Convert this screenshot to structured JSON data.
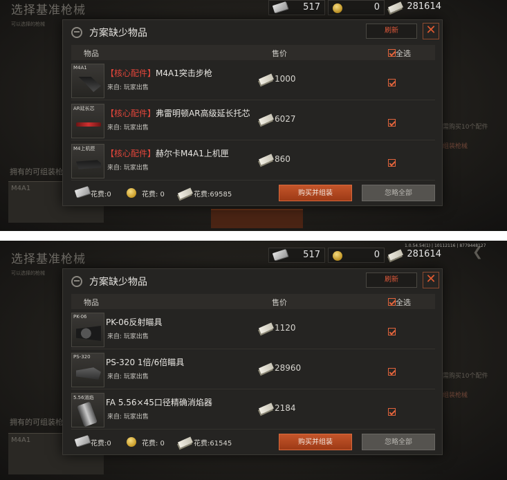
{
  "screens": [
    {
      "bg": {
        "title": "选择基准枪械",
        "subtitle": "可以选择的枪械",
        "owned_label": "拥有的可组装枪",
        "owned_weapon": "M4A1",
        "right_text_1": "需购买10个配件",
        "right_text_2": "组装枪械"
      },
      "version": "",
      "currency": {
        "cash": "517",
        "coin": "0",
        "money": "281614"
      },
      "dialog": {
        "title": "方案缺少物品",
        "refresh": "刷新",
        "close": "✕",
        "col_item": "物品",
        "col_price": "售价",
        "col_all": "全选",
        "rows": [
          {
            "tag": "M4A1",
            "core": "【核心配件】",
            "name": "M4A1突击步枪",
            "source": "来自:  玩家出售",
            "price": "1000",
            "checked": true
          },
          {
            "tag": "AR延长芯",
            "core": "【核心配件】",
            "name": "弗雷明顿AR高级延长托芯",
            "source": "来自:  玩家出售",
            "price": "6027",
            "checked": true
          },
          {
            "tag": "M4上机匣",
            "core": "【核心配件】",
            "name": "赫尔卡M4A1上机匣",
            "source": "来自:  玩家出售",
            "price": "860",
            "checked": true
          }
        ],
        "cost_1": "花费:0",
        "cost_2": "花费: 0",
        "cost_3": "花费:69585",
        "buy": "购买并组装",
        "ignore": "忽略全部"
      }
    },
    {
      "bg": {
        "title": "选择基准枪械",
        "subtitle": "可以选择的枪械",
        "owned_label": "拥有的可组装枪",
        "owned_weapon": "M4A1",
        "right_text_1": "需购买10个配件",
        "right_text_2": "组装枪械"
      },
      "version": "1.0.54.54(1) | 10112116 | 8779448127",
      "currency": {
        "cash": "517",
        "coin": "0",
        "money": "281614"
      },
      "dialog": {
        "title": "方案缺少物品",
        "refresh": "刷新",
        "close": "✕",
        "col_item": "物品",
        "col_price": "售价",
        "col_all": "全选",
        "rows": [
          {
            "tag": "PK-06",
            "core": "",
            "name": "PK-06反射瞄具",
            "source": "来自:  玩家出售",
            "price": "1120",
            "checked": true
          },
          {
            "tag": "PS-320",
            "core": "",
            "name": "PS-320 1倍/6倍瞄具",
            "source": "来自:  玩家出售",
            "price": "28960",
            "checked": true
          },
          {
            "tag": "5.56消焰",
            "core": "",
            "name": "FA 5.56×45口径精确消焰器",
            "source": "来自:  玩家出售",
            "price": "2184",
            "checked": true
          }
        ],
        "cost_1": "花费:0",
        "cost_2": "花费: 0",
        "cost_3": "花费:61545",
        "buy": "购买并组装",
        "ignore": "忽略全部"
      }
    }
  ]
}
